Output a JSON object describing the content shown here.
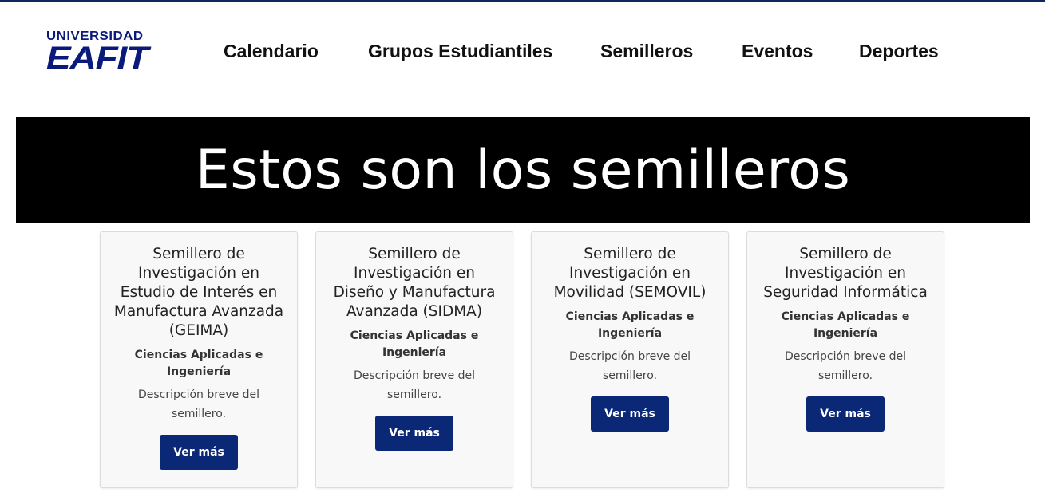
{
  "header": {
    "logo_line1": "UNIVERSIDAD",
    "logo_line2": "EAFIT",
    "nav": [
      {
        "label": "Calendario"
      },
      {
        "label": "Grupos Estudiantiles"
      },
      {
        "label": "Semilleros"
      },
      {
        "label": "Eventos"
      },
      {
        "label": "Deportes"
      }
    ]
  },
  "banner": {
    "title": "Estos son los semilleros"
  },
  "cards": [
    {
      "title": "Semillero de Investigación en Estudio de Interés en Manufactura Avanzada (GEIMA)",
      "area": "Ciencias Aplicadas e Ingeniería",
      "description": "Descripción breve del semillero.",
      "button": "Ver más"
    },
    {
      "title": "Semillero de Investigación en Diseño y Manufactura Avanzada (SIDMA)",
      "area": "Ciencias Aplicadas e Ingeniería",
      "description": "Descripción breve del semillero.",
      "button": "Ver más"
    },
    {
      "title": "Semillero de Investigación en Movilidad (SEMOVIL)",
      "area": "Ciencias Aplicadas e Ingeniería",
      "description": "Descripción breve del semillero.",
      "button": "Ver más"
    },
    {
      "title": "Semillero de Investigación en Seguridad Informática",
      "area": "Ciencias Aplicadas e Ingeniería",
      "description": "Descripción breve del semillero.",
      "button": "Ver más"
    }
  ],
  "colors": {
    "brand_navy": "#0a1a7a",
    "button_bg": "#0a2876",
    "banner_bg": "#000000"
  }
}
